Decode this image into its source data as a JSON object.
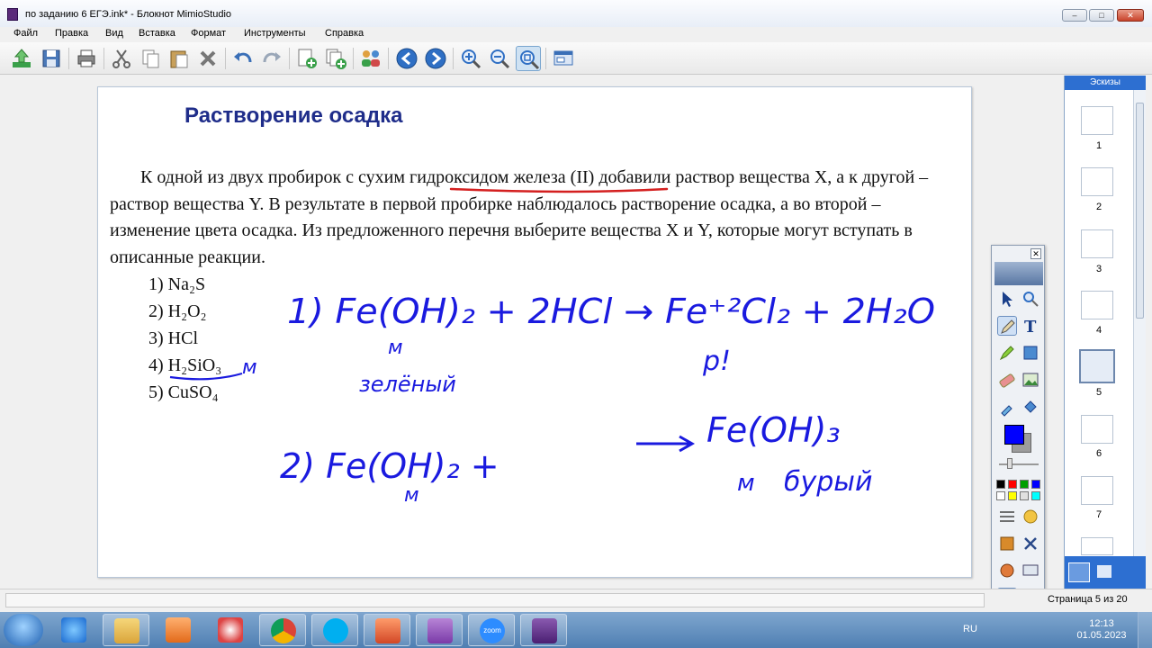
{
  "window": {
    "title": "по заданию 6 ЕГЭ.ink* - Блокнот MimioStudio",
    "controls": [
      "–",
      "□",
      "✕"
    ]
  },
  "menu": [
    "Файл",
    "Правка",
    "Вид",
    "Вставка",
    "Формат",
    "Инструменты",
    "Справка"
  ],
  "toolbar_icons": [
    "import-icon",
    "save-icon",
    "print-icon",
    "cut-icon",
    "copy-icon",
    "paste-icon",
    "delete-icon",
    "undo-icon",
    "redo-icon",
    "new-page-icon",
    "duplicate-page-icon",
    "users-icon",
    "back-icon",
    "forward-icon",
    "zoom-in-icon",
    "zoom-out-icon",
    "zoom-fit-icon",
    "screen-icon"
  ],
  "slide": {
    "heading": "Растворение осадка",
    "task_text": "К одной из двух пробирок с сухим гидроксидом железа (II) добавили раствор вещества X, а к другой – раствор вещества Y. В результате в первой пробирке наблюдалось растворение осадка, а во второй – изменение цвета осадка. Из предложенного перечня выберите вещества X и Y, которые могут вступать в описанные реакции.",
    "options": [
      "1) Na₂S",
      "2) H₂O₂",
      "3) HCl",
      "4) H₂SiO₃",
      "5) CuSO₄"
    ],
    "handwriting": {
      "opt4_mark": "м",
      "eq1": "1) Fe(OH)₂ + 2HCl → Fe⁺²Cl₂ + 2H₂O",
      "eq1_notes": [
        "м",
        "зелёный",
        "р!"
      ],
      "eq2": "2) Fe(OH)₂ + → Fe(OH)₃",
      "eq2_notes": [
        "м",
        "м",
        "бурый"
      ],
      "ink_color": "#1a1adf",
      "underline_color": "#d42020"
    }
  },
  "thumbnails": {
    "header": "Эскизы",
    "items": [
      "1",
      "2",
      "3",
      "4",
      "5",
      "6",
      "7"
    ],
    "selected": "5"
  },
  "palette": {
    "main_color": "#0000ff",
    "colors": [
      "#000000",
      "#ff0000",
      "#00a000",
      "#0000ff",
      "#ffffff",
      "#ffff00",
      "#e0e0e0",
      "#00ffff"
    ]
  },
  "status": {
    "page_info": "Страница 5 из 20"
  },
  "taskbar": {
    "lang": "RU",
    "time": "12:13",
    "date": "01.05.2023",
    "apps": [
      "ie-icon",
      "explorer-icon",
      "media-player-icon",
      "ccleaner-icon",
      "chrome-icon",
      "skype-icon",
      "powerpoint-icon",
      "onenote-icon",
      "zoom-icon",
      "mimio-icon"
    ],
    "zoom_label": "zoom"
  }
}
